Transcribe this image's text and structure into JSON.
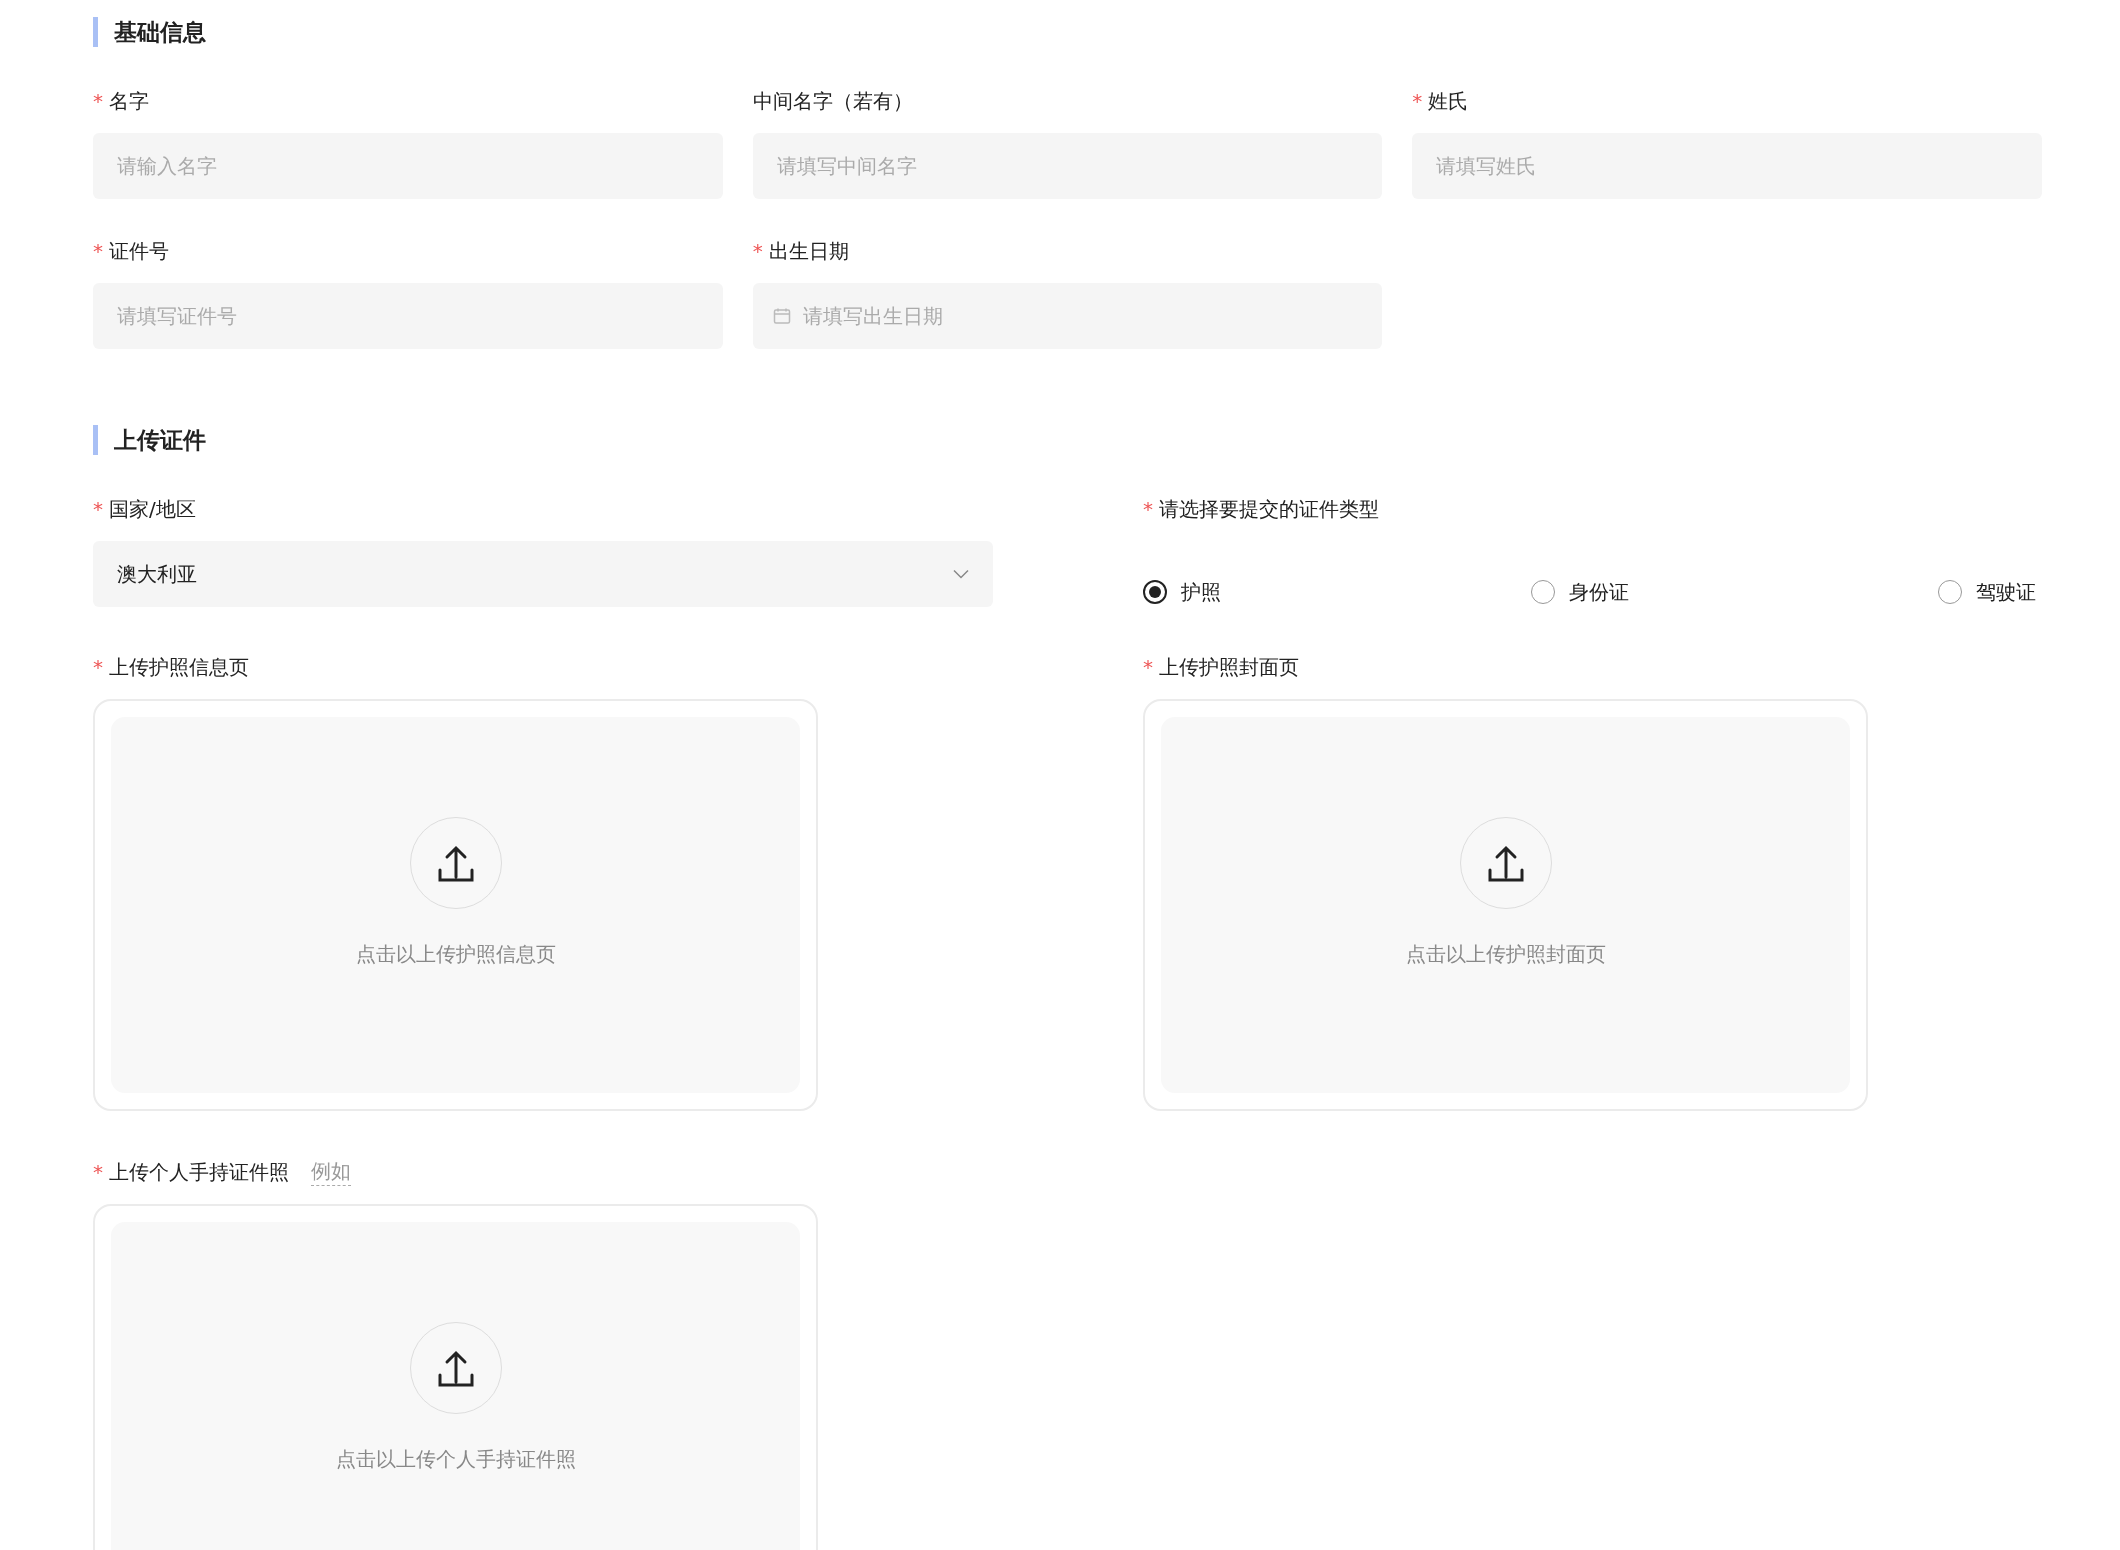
{
  "basic_info": {
    "title": "基础信息",
    "fields": [
      {
        "label": "名字",
        "required_mark": "*",
        "kind": "text",
        "placeholder": "请输入名字"
      },
      {
        "label": "中间名字（若有）",
        "kind": "text",
        "placeholder": "请填写中间名字"
      },
      {
        "label": "姓氏",
        "required_mark": "*",
        "kind": "text",
        "placeholder": "请填写姓氏"
      },
      {
        "label": "证件号",
        "required_mark": "*",
        "kind": "text",
        "placeholder": "请填写证件号"
      },
      {
        "label": "出生日期",
        "required_mark": "*",
        "kind": "date",
        "placeholder": "请填写出生日期"
      }
    ]
  },
  "upload": {
    "title": "上传证件",
    "country": {
      "label": "国家/地区",
      "required_mark": "*",
      "value": "澳大利亚"
    },
    "id_type": {
      "label": "请选择要提交的证件类型",
      "required_mark": "*",
      "options": [
        {
          "label": "护照",
          "selected": true
        },
        {
          "label": "身份证",
          "selected": false
        },
        {
          "label": "驾驶证",
          "selected": false
        }
      ]
    },
    "uploads": [
      {
        "label": "上传护照信息页",
        "required_mark": "*",
        "hint": "点击以上传护照信息页"
      },
      {
        "label": "上传护照封面页",
        "required_mark": "*",
        "hint": "点击以上传护照封面页"
      },
      {
        "label": "上传个人手持证件照",
        "required_mark": "*",
        "example": "例如",
        "hint": "点击以上传个人手持证件照"
      }
    ]
  }
}
